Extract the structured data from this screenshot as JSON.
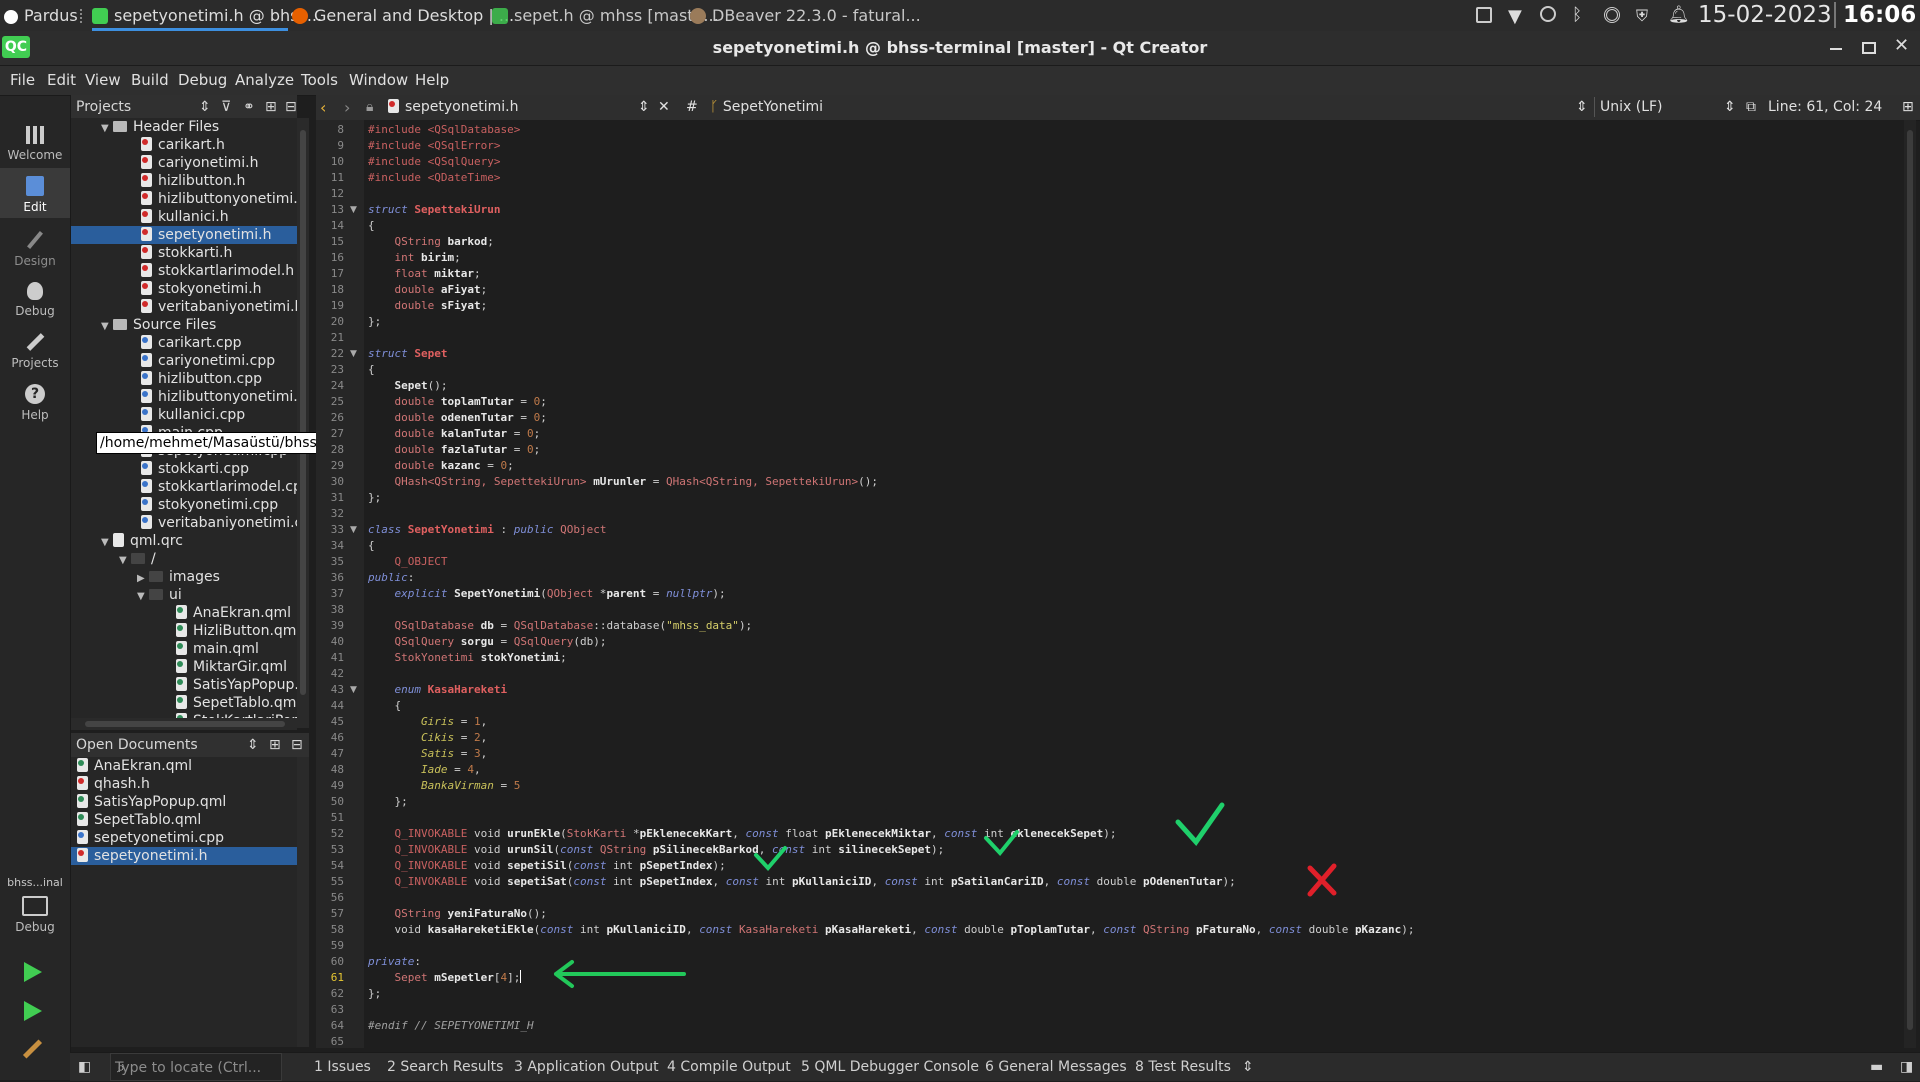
{
  "taskbar": {
    "distro": "Pardus",
    "tasks": [
      "sepetyonetimi.h @ bhss...",
      "General and Desktop | ...",
      "sepet.h @ mhss [maste...",
      "DBeaver 22.3.0 - fatural..."
    ],
    "date": "15-02-2023",
    "time": "16:06"
  },
  "window": {
    "app_icon": "QC",
    "title": "sepetyonetimi.h @ bhss-terminal [master] - Qt Creator"
  },
  "menu": [
    "File",
    "Edit",
    "View",
    "Build",
    "Debug",
    "Analyze",
    "Tools",
    "Window",
    "Help"
  ],
  "modes": [
    "Welcome",
    "Edit",
    "Design",
    "Debug",
    "Projects",
    "Help"
  ],
  "kit": {
    "label": "bhss...inal",
    "mode": "Debug"
  },
  "projects": {
    "header": "Projects",
    "header_files": "Header Files",
    "header_items": [
      "carikart.h",
      "cariyonetimi.h",
      "hizlibutton.h",
      "hizlibuttonyonetimi.h",
      "kullanici.h",
      "sepetyonetimi.h",
      "stokkarti.h",
      "stokkartlarimodel.h",
      "stokyonetimi.h",
      "veritabaniyonetimi.h"
    ],
    "source_files": "Source Files",
    "source_items": [
      "carikart.cpp",
      "cariyonetimi.cpp",
      "hizlibutton.cpp",
      "hizlibuttonyonetimi.c",
      "kullanici.cpp",
      "main.cpp",
      "sepetyonetimi.cpp",
      "stokkarti.cpp",
      "stokkartlarimodel.cpp",
      "stokyonetimi.cpp",
      "veritabaniyonetimi.cp"
    ],
    "qrc": "qml.qrc",
    "root": "/",
    "images": "images",
    "ui": "ui",
    "qml_items": [
      "AnaEkran.qml",
      "HizliButton.qml",
      "main.qml",
      "MiktarGir.qml",
      "SatisYapPopup.q",
      "SepetTablo.qml",
      "StokKartlariPopl..."
    ],
    "tooltip": "/home/mehmet/Masaüstü/bhss-terminal/kullanici.cpp"
  },
  "open_documents": {
    "header": "Open Documents",
    "items": [
      "AnaEkran.qml",
      "qhash.h",
      "SatisYapPopup.qml",
      "SepetTablo.qml",
      "sepetyonetimi.cpp",
      "sepetyonetimi.h"
    ]
  },
  "editor": {
    "file": "sepetyonetimi.h",
    "symbol": "SepetYonetimi",
    "line_ending": "Unix (LF)",
    "position": "Line: 61, Col: 24",
    "first_line": 8,
    "current_line": 61
  },
  "locator": {
    "placeholder": "Type to locate (Ctrl..."
  },
  "output_tabs": [
    "1 Issues",
    "2 Search Results",
    "3 Application Output",
    "4 Compile Output",
    "5 QML Debugger Console",
    "6 General Messages",
    "8 Test Results"
  ],
  "annotations": {
    "check_color": "#1fd06b",
    "cross_color": "#e0202a",
    "arrow_color": "#22c85a"
  }
}
